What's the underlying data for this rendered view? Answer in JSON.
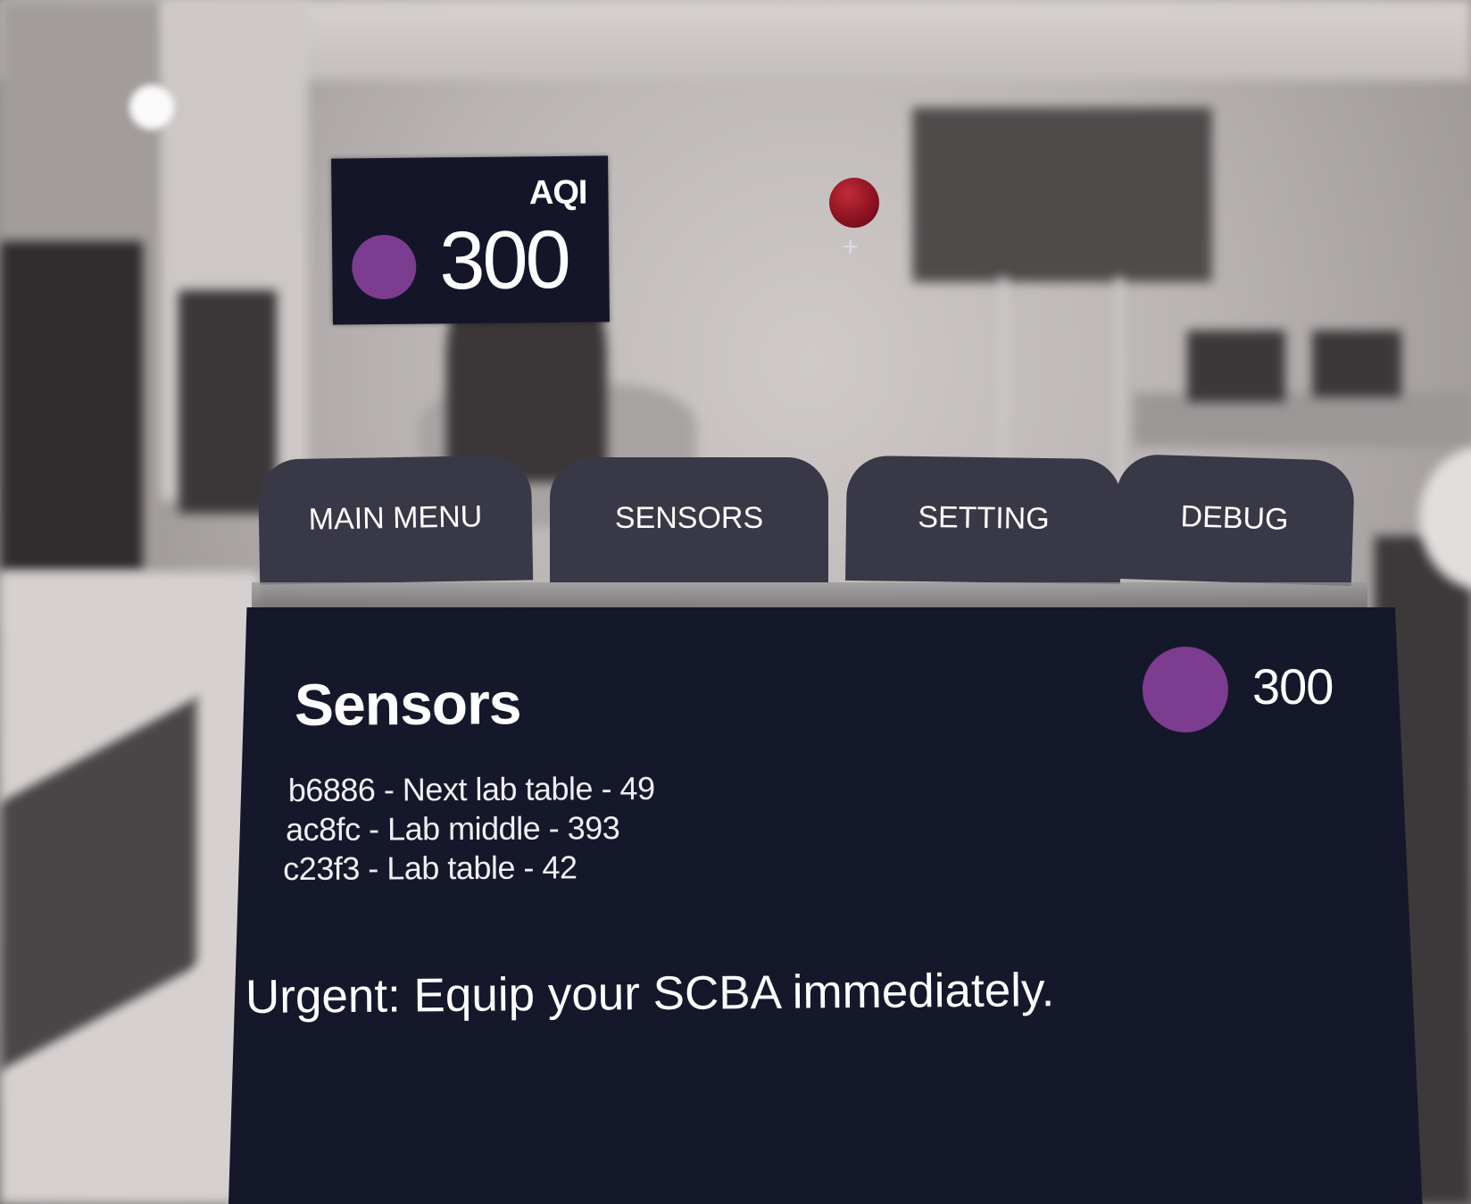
{
  "aqi_badge": {
    "label": "AQI",
    "value": "300",
    "indicator_color": "#7c3c8f"
  },
  "gaze_cursor": {
    "icon": "gaze-sphere-icon",
    "crosshair_icon": "crosshair-icon",
    "crosshair_glyph": "+",
    "color": "#9b1827"
  },
  "tabs": [
    {
      "id": "main-menu",
      "label": "MAIN MENU"
    },
    {
      "id": "sensors",
      "label": "SENSORS"
    },
    {
      "id": "setting",
      "label": "SETTING"
    },
    {
      "id": "debug",
      "label": "DEBUG"
    }
  ],
  "panel": {
    "title": "Sensors",
    "aqi_value": "300",
    "indicator_color": "#7c3c8f",
    "sensors": [
      "b6886 - Next lab table - 49",
      "ac8fc - Lab middle - 393",
      "c23f3 - Lab table - 42"
    ],
    "alert": "Urgent: Equip your SCBA immediately."
  },
  "colors": {
    "panel_bg": "#15182a",
    "tab_bg": "#393847",
    "text": "#ffffff"
  }
}
